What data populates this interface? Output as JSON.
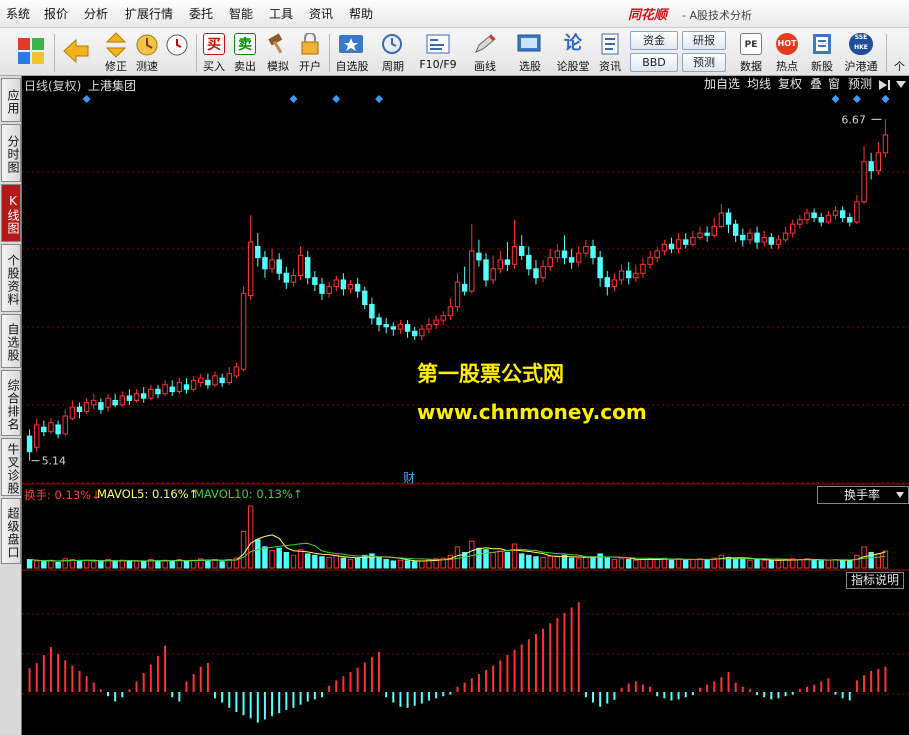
{
  "menu": [
    "系统",
    "报价",
    "分析",
    "扩展行情",
    "委托",
    "智能",
    "工具",
    "资讯",
    "帮助"
  ],
  "brand": {
    "logo": "同花顺",
    "subtitle": "- A股技术分析"
  },
  "toolbar": {
    "items": [
      {
        "label": "",
        "icon": "back-arrow-icon"
      },
      {
        "label": "修正",
        "icon": "up-down-icon"
      },
      {
        "label": "测速",
        "icon": "clock-icon"
      },
      {
        "label": "买入",
        "icon": "buy-icon",
        "glyph": "买"
      },
      {
        "label": "卖出",
        "icon": "sell-icon",
        "glyph": "卖"
      },
      {
        "label": "模拟",
        "icon": "hammer-icon"
      },
      {
        "label": "开户",
        "icon": "lock-icon"
      },
      {
        "label": "自选股",
        "icon": "star-icon"
      },
      {
        "label": "周期",
        "icon": "cycle-icon"
      },
      {
        "label": "F10/F9",
        "icon": "f10-icon"
      },
      {
        "label": "画线",
        "icon": "pen-icon"
      },
      {
        "label": "选股",
        "icon": "screen-icon"
      },
      {
        "label": "论股堂",
        "icon": "forum-icon",
        "glyph": "论"
      },
      {
        "label": "资讯",
        "icon": "news-icon"
      },
      {
        "label": "数据",
        "icon": "pe-icon",
        "glyph": "PE"
      },
      {
        "label": "热点",
        "icon": "hot-icon",
        "glyph": "HOT"
      },
      {
        "label": "新股",
        "icon": "ipo-icon"
      },
      {
        "label": "沪港通",
        "icon": "hk-icon",
        "glyph": "SSE HKE"
      }
    ],
    "box_buttons": [
      "资金",
      "BBD",
      "研报",
      "预测"
    ],
    "edge_label": "个"
  },
  "side_tabs": [
    {
      "label": "应用",
      "active": false
    },
    {
      "label": "分时图",
      "active": false
    },
    {
      "label": "K线图",
      "active": true
    },
    {
      "label": "个股资料",
      "active": false
    },
    {
      "label": "自选股",
      "active": false
    },
    {
      "label": "综合排名",
      "active": false
    },
    {
      "label": "牛叉诊股",
      "active": false
    },
    {
      "label": "超级盘口",
      "active": false
    }
  ],
  "chart_header": {
    "title": "日线(复权)",
    "stock": "上港集团",
    "buttons": [
      "加自选",
      "均线",
      "复权",
      "叠",
      "窗",
      "预测"
    ]
  },
  "price_labels": {
    "high": "6.67",
    "low": "5.14"
  },
  "watermark": {
    "line1": "第一股票公式网",
    "line2": "www.chnmoney.com"
  },
  "cai_badge": "财",
  "volume_header": {
    "label": "换手: 0.13%↓",
    "mavol5": "MAVOL5: 0.16%↑",
    "mavol10": "MAVOL10: 0.13%↑",
    "dropdown": "换手率"
  },
  "indicator_button": "指标说明",
  "colors": {
    "up": "#ff3232",
    "down": "#54ffff",
    "ma5": "#ffff60",
    "ma10": "#40d040",
    "grid": "#7a0000",
    "bg": "#000000"
  },
  "chart_data": {
    "type": "candlestick",
    "price_range": [
      5.14,
      6.67
    ],
    "candles": [
      [
        5.25,
        5.18,
        5.28,
        5.14
      ],
      [
        5.2,
        5.3,
        5.33,
        5.18
      ],
      [
        5.29,
        5.27,
        5.32,
        5.25
      ],
      [
        5.27,
        5.31,
        5.33,
        5.26
      ],
      [
        5.3,
        5.26,
        5.32,
        5.24
      ],
      [
        5.26,
        5.34,
        5.37,
        5.25
      ],
      [
        5.33,
        5.38,
        5.41,
        5.32
      ],
      [
        5.38,
        5.36,
        5.4,
        5.33
      ],
      [
        5.36,
        5.4,
        5.42,
        5.35
      ],
      [
        5.39,
        5.41,
        5.44,
        5.37
      ],
      [
        5.4,
        5.37,
        5.42,
        5.35
      ],
      [
        5.38,
        5.42,
        5.44,
        5.36
      ],
      [
        5.41,
        5.39,
        5.44,
        5.38
      ],
      [
        5.39,
        5.43,
        5.45,
        5.38
      ],
      [
        5.43,
        5.41,
        5.46,
        5.39
      ],
      [
        5.41,
        5.44,
        5.46,
        5.4
      ],
      [
        5.44,
        5.42,
        5.47,
        5.4
      ],
      [
        5.42,
        5.46,
        5.48,
        5.41
      ],
      [
        5.46,
        5.44,
        5.48,
        5.42
      ],
      [
        5.44,
        5.48,
        5.5,
        5.43
      ],
      [
        5.47,
        5.45,
        5.5,
        5.43
      ],
      [
        5.45,
        5.49,
        5.51,
        5.44
      ],
      [
        5.48,
        5.46,
        5.51,
        5.44
      ],
      [
        5.46,
        5.5,
        5.52,
        5.45
      ],
      [
        5.49,
        5.51,
        5.53,
        5.47
      ],
      [
        5.5,
        5.48,
        5.53,
        5.46
      ],
      [
        5.48,
        5.52,
        5.54,
        5.47
      ],
      [
        5.51,
        5.49,
        5.53,
        5.47
      ],
      [
        5.49,
        5.53,
        5.56,
        5.48
      ],
      [
        5.52,
        5.56,
        5.58,
        5.51
      ],
      [
        5.55,
        5.89,
        5.92,
        5.54
      ],
      [
        5.88,
        6.12,
        6.24,
        5.86
      ],
      [
        6.1,
        6.05,
        6.16,
        6.01
      ],
      [
        6.05,
        6.0,
        6.08,
        5.96
      ],
      [
        6.0,
        6.04,
        6.09,
        5.98
      ],
      [
        6.04,
        5.98,
        6.07,
        5.95
      ],
      [
        5.98,
        5.94,
        6.01,
        5.91
      ],
      [
        5.94,
        5.97,
        6.0,
        5.92
      ],
      [
        5.97,
        6.06,
        6.1,
        5.95
      ],
      [
        6.05,
        5.96,
        6.08,
        5.93
      ],
      [
        5.96,
        5.93,
        5.99,
        5.9
      ],
      [
        5.93,
        5.89,
        5.96,
        5.86
      ],
      [
        5.89,
        5.92,
        5.94,
        5.87
      ],
      [
        5.92,
        5.95,
        5.97,
        5.9
      ],
      [
        5.95,
        5.91,
        5.98,
        5.88
      ],
      [
        5.91,
        5.93,
        5.95,
        5.89
      ],
      [
        5.93,
        5.9,
        5.96,
        5.87
      ],
      [
        5.9,
        5.84,
        5.92,
        5.82
      ],
      [
        5.84,
        5.78,
        5.87,
        5.75
      ],
      [
        5.78,
        5.75,
        5.8,
        5.72
      ],
      [
        5.75,
        5.74,
        5.78,
        5.71
      ],
      [
        5.74,
        5.73,
        5.76,
        5.7
      ],
      [
        5.73,
        5.75,
        5.77,
        5.71
      ],
      [
        5.75,
        5.72,
        5.77,
        5.69
      ],
      [
        5.72,
        5.7,
        5.74,
        5.68
      ],
      [
        5.7,
        5.73,
        5.75,
        5.68
      ],
      [
        5.73,
        5.75,
        5.78,
        5.71
      ],
      [
        5.75,
        5.77,
        5.79,
        5.73
      ],
      [
        5.77,
        5.79,
        5.81,
        5.75
      ],
      [
        5.79,
        5.83,
        5.87,
        5.77
      ],
      [
        5.83,
        5.94,
        5.98,
        5.81
      ],
      [
        5.93,
        5.9,
        6.01,
        5.88
      ],
      [
        5.9,
        6.08,
        6.2,
        5.89
      ],
      [
        6.07,
        6.04,
        6.13,
        6.01
      ],
      [
        6.04,
        5.95,
        6.07,
        5.92
      ],
      [
        5.95,
        6.0,
        6.06,
        5.93
      ],
      [
        6.0,
        6.04,
        6.08,
        5.98
      ],
      [
        6.04,
        6.02,
        6.12,
        5.99
      ],
      [
        6.02,
        6.1,
        6.22,
        6.0
      ],
      [
        6.1,
        6.06,
        6.15,
        6.04
      ],
      [
        6.06,
        6.0,
        6.1,
        5.97
      ],
      [
        6.0,
        5.96,
        6.04,
        5.93
      ],
      [
        5.96,
        6.01,
        6.04,
        5.94
      ],
      [
        6.01,
        6.05,
        6.09,
        5.99
      ],
      [
        6.05,
        6.08,
        6.11,
        6.03
      ],
      [
        6.08,
        6.05,
        6.15,
        6.02
      ],
      [
        6.05,
        6.03,
        6.09,
        6.0
      ],
      [
        6.03,
        6.07,
        6.1,
        6.01
      ],
      [
        6.07,
        6.1,
        6.13,
        6.05
      ],
      [
        6.1,
        6.05,
        6.13,
        6.02
      ],
      [
        6.05,
        5.96,
        6.08,
        5.92
      ],
      [
        5.96,
        5.92,
        5.99,
        5.88
      ],
      [
        5.92,
        5.95,
        5.98,
        5.9
      ],
      [
        5.95,
        5.99,
        6.02,
        5.93
      ],
      [
        5.99,
        5.96,
        6.03,
        5.93
      ],
      [
        5.96,
        5.98,
        6.02,
        5.94
      ],
      [
        5.98,
        6.02,
        6.05,
        5.96
      ],
      [
        6.02,
        6.05,
        6.08,
        6.0
      ],
      [
        6.05,
        6.08,
        6.1,
        6.03
      ],
      [
        6.08,
        6.11,
        6.13,
        6.06
      ],
      [
        6.11,
        6.09,
        6.14,
        6.07
      ],
      [
        6.09,
        6.13,
        6.16,
        6.07
      ],
      [
        6.13,
        6.11,
        6.16,
        6.09
      ],
      [
        6.11,
        6.14,
        6.17,
        6.1
      ],
      [
        6.14,
        6.16,
        6.19,
        6.13
      ],
      [
        6.16,
        6.15,
        6.19,
        6.12
      ],
      [
        6.15,
        6.19,
        6.23,
        6.14
      ],
      [
        6.19,
        6.25,
        6.29,
        6.18
      ],
      [
        6.25,
        6.2,
        6.27,
        6.16
      ],
      [
        6.2,
        6.15,
        6.22,
        6.12
      ],
      [
        6.15,
        6.13,
        6.18,
        6.1
      ],
      [
        6.13,
        6.16,
        6.18,
        6.11
      ],
      [
        6.16,
        6.12,
        6.19,
        6.09
      ],
      [
        6.12,
        6.14,
        6.17,
        6.1
      ],
      [
        6.14,
        6.11,
        6.16,
        6.09
      ],
      [
        6.11,
        6.13,
        6.15,
        6.09
      ],
      [
        6.13,
        6.16,
        6.19,
        6.12
      ],
      [
        6.16,
        6.2,
        6.22,
        6.14
      ],
      [
        6.2,
        6.22,
        6.24,
        6.18
      ],
      [
        6.22,
        6.25,
        6.27,
        6.2
      ],
      [
        6.25,
        6.23,
        6.27,
        6.21
      ],
      [
        6.23,
        6.21,
        6.25,
        6.19
      ],
      [
        6.21,
        6.24,
        6.26,
        6.2
      ],
      [
        6.24,
        6.26,
        6.28,
        6.22
      ],
      [
        6.26,
        6.23,
        6.28,
        6.21
      ],
      [
        6.23,
        6.21,
        6.25,
        6.19
      ],
      [
        6.21,
        6.3,
        6.33,
        6.2
      ],
      [
        6.3,
        6.48,
        6.55,
        6.29
      ],
      [
        6.48,
        6.44,
        6.52,
        6.4
      ],
      [
        6.44,
        6.52,
        6.57,
        6.42
      ],
      [
        6.52,
        6.6,
        6.67,
        6.5
      ]
    ],
    "volume": [
      0.12,
      0.1,
      0.09,
      0.11,
      0.08,
      0.13,
      0.12,
      0.1,
      0.11,
      0.09,
      0.1,
      0.12,
      0.09,
      0.11,
      0.1,
      0.1,
      0.09,
      0.12,
      0.1,
      0.11,
      0.09,
      0.12,
      0.1,
      0.11,
      0.13,
      0.1,
      0.12,
      0.09,
      0.12,
      0.14,
      0.52,
      0.88,
      0.4,
      0.3,
      0.25,
      0.28,
      0.22,
      0.18,
      0.26,
      0.2,
      0.18,
      0.16,
      0.15,
      0.18,
      0.14,
      0.12,
      0.14,
      0.18,
      0.2,
      0.15,
      0.12,
      0.1,
      0.11,
      0.1,
      0.09,
      0.1,
      0.12,
      0.13,
      0.14,
      0.18,
      0.3,
      0.22,
      0.38,
      0.28,
      0.26,
      0.22,
      0.24,
      0.22,
      0.34,
      0.2,
      0.18,
      0.16,
      0.15,
      0.17,
      0.16,
      0.18,
      0.14,
      0.13,
      0.15,
      0.16,
      0.2,
      0.14,
      0.12,
      0.13,
      0.12,
      0.11,
      0.12,
      0.13,
      0.12,
      0.14,
      0.11,
      0.13,
      0.11,
      0.12,
      0.13,
      0.11,
      0.14,
      0.18,
      0.15,
      0.14,
      0.12,
      0.11,
      0.12,
      0.11,
      0.1,
      0.11,
      0.12,
      0.13,
      0.12,
      0.13,
      0.11,
      0.1,
      0.11,
      0.12,
      0.11,
      0.1,
      0.18,
      0.3,
      0.22,
      0.2,
      0.24
    ],
    "macd": [
      0.45,
      0.55,
      0.7,
      0.85,
      0.72,
      0.6,
      0.5,
      0.4,
      0.3,
      0.18,
      0.05,
      -0.08,
      -0.18,
      -0.1,
      0.05,
      0.2,
      0.36,
      0.52,
      0.68,
      0.88,
      -0.1,
      -0.18,
      0.2,
      0.34,
      0.48,
      0.55,
      -0.12,
      -0.2,
      -0.3,
      -0.38,
      -0.44,
      -0.5,
      -0.58,
      -0.52,
      -0.46,
      -0.4,
      -0.34,
      -0.3,
      -0.24,
      -0.18,
      -0.14,
      -0.1,
      0.12,
      0.22,
      0.3,
      0.38,
      0.46,
      0.56,
      0.66,
      0.76,
      -0.1,
      -0.2,
      -0.28,
      -0.3,
      -0.26,
      -0.22,
      -0.16,
      -0.12,
      -0.08,
      -0.05,
      0.1,
      0.18,
      0.26,
      0.34,
      0.42,
      0.5,
      0.6,
      0.7,
      0.8,
      0.9,
      1.0,
      1.1,
      1.2,
      1.3,
      1.4,
      1.5,
      1.6,
      1.7,
      -0.1,
      -0.2,
      -0.28,
      -0.22,
      -0.15,
      0.08,
      0.16,
      0.2,
      0.14,
      0.1,
      -0.08,
      -0.12,
      -0.16,
      -0.14,
      -0.1,
      -0.06,
      0.08,
      0.14,
      0.2,
      0.28,
      0.38,
      0.18,
      0.1,
      0.06,
      -0.06,
      -0.1,
      -0.14,
      -0.12,
      -0.08,
      -0.05,
      0.06,
      0.1,
      0.14,
      0.2,
      0.26,
      -0.05,
      -0.12,
      -0.16,
      0.22,
      0.32,
      0.4,
      0.44,
      0.48
    ]
  }
}
